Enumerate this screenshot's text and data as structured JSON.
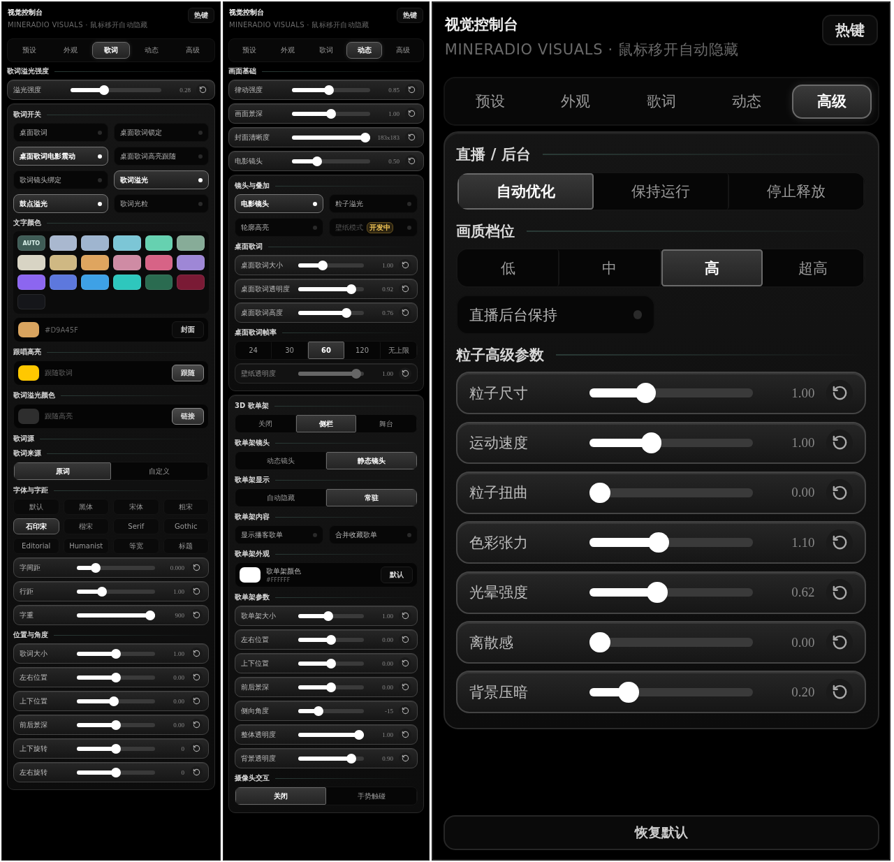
{
  "panels": [
    {
      "title": "视觉控制台",
      "subtitle": "MINERADIO VISUALS · 鼠标移开自动隐藏",
      "hotkey": "热键",
      "tabs": [
        {
          "label": "预设",
          "selected": false
        },
        {
          "label": "外观",
          "selected": false
        },
        {
          "label": "歌词",
          "selected": true
        },
        {
          "label": "动态",
          "selected": false
        },
        {
          "label": "高级",
          "selected": false
        }
      ],
      "blocks": [
        {
          "kind": "section",
          "label": "歌词溢光强度"
        },
        {
          "kind": "slider",
          "label": "溢光强度",
          "level": 0.35,
          "reading": "0.28",
          "disabled": false
        },
        {
          "kind": "card",
          "blocks": [
            {
              "kind": "section",
              "label": "歌词开关"
            },
            {
              "kind": "toggles",
              "items": [
                {
                  "label": "桌面歌词",
                  "on": false,
                  "disabled": false
                },
                {
                  "label": "桌面歌词锁定",
                  "on": false,
                  "disabled": false
                },
                {
                  "label": "桌面歌词电影震动",
                  "on": true,
                  "disabled": false
                },
                {
                  "label": "桌面歌词高亮跟随",
                  "on": false,
                  "disabled": false
                },
                {
                  "label": "歌词镜头绑定",
                  "on": false,
                  "disabled": false
                },
                {
                  "label": "歌词溢光",
                  "on": true,
                  "disabled": false
                },
                {
                  "label": "鼓点溢光",
                  "on": true,
                  "disabled": false
                },
                {
                  "label": "歌词光粒",
                  "on": false,
                  "disabled": false
                }
              ]
            },
            {
              "kind": "section",
              "label": "文字颜色"
            },
            {
              "kind": "swatches",
              "items": [
                {
                  "label": "AUTO",
                  "color": "#3f5c56"
                },
                {
                  "color": "#a9b8cf"
                },
                {
                  "color": "#9fb5cf"
                },
                {
                  "color": "#7cc6d6"
                },
                {
                  "color": "#66d1b0"
                },
                {
                  "color": "#87ac98"
                },
                {
                  "color": "#d8d4c4"
                },
                {
                  "color": "#cfb883"
                },
                {
                  "color": "#dfa55f"
                },
                {
                  "color": "#cf8ba4"
                },
                {
                  "color": "#d76386"
                },
                {
                  "color": "#9e87d6"
                },
                {
                  "color": "#8c66f0"
                },
                {
                  "color": "#5d78dd"
                },
                {
                  "color": "#3ea1e6"
                },
                {
                  "color": "#2ec7bd"
                },
                {
                  "color": "#2a6b50"
                },
                {
                  "color": "#7a1a35"
                },
                {
                  "color": "#15161a"
                }
              ]
            },
            {
              "kind": "color_row",
              "color": "#d9a45f",
              "label": "#D9A45F",
              "button": "封面",
              "active": false
            },
            {
              "kind": "section",
              "label": "跟唱高亮"
            },
            {
              "kind": "color_row",
              "color": "#ffc800",
              "label": "跟随歌词",
              "button": "跟随",
              "active": true
            },
            {
              "kind": "section",
              "label": "歌词溢光颜色"
            },
            {
              "kind": "color_row",
              "color": "#2e2e2e",
              "label": "跟随高亮",
              "button": "链接",
              "active": true
            },
            {
              "kind": "section",
              "label": "歌词源"
            },
            {
              "kind": "section",
              "label": "歌词来源"
            },
            {
              "kind": "segmented",
              "options": [
                {
                  "label": "原词",
                  "selected": true
                },
                {
                  "label": "自定义",
                  "selected": false
                }
              ]
            },
            {
              "kind": "section",
              "label": "字体与字距"
            },
            {
              "kind": "font_grid",
              "options": [
                {
                  "label": "默认",
                  "selected": false
                },
                {
                  "label": "黑体",
                  "selected": false
                },
                {
                  "label": "宋体",
                  "selected": false
                },
                {
                  "label": "粗宋",
                  "selected": false
                },
                {
                  "label": "石印宋",
                  "selected": true
                },
                {
                  "label": "楷宋",
                  "selected": false
                },
                {
                  "label": "Serif",
                  "selected": false
                },
                {
                  "label": "Gothic",
                  "selected": false
                },
                {
                  "label": "Editorial",
                  "selected": false
                },
                {
                  "label": "Humanist",
                  "selected": false
                },
                {
                  "label": "等宽",
                  "selected": false
                },
                {
                  "label": "标题",
                  "selected": false
                }
              ]
            },
            {
              "kind": "slider",
              "label": "字间距",
              "level": 0.2,
              "reading": "0.000",
              "disabled": false
            },
            {
              "kind": "slider",
              "label": "行距",
              "level": 0.3,
              "reading": "1.00",
              "disabled": false
            },
            {
              "kind": "slider",
              "label": "字重",
              "level": 1,
              "reading": "900",
              "disabled": false
            },
            {
              "kind": "section",
              "label": "位置与角度"
            },
            {
              "kind": "slider",
              "label": "歌词大小",
              "level": 0.5,
              "reading": "1.00",
              "disabled": false
            },
            {
              "kind": "slider",
              "label": "左右位置",
              "level": 0.5,
              "reading": "0.00",
              "disabled": false
            },
            {
              "kind": "slider",
              "label": "上下位置",
              "level": 0.47,
              "reading": "0.00",
              "disabled": false
            },
            {
              "kind": "slider",
              "label": "前后景深",
              "level": 0.5,
              "reading": "0.00",
              "disabled": false
            },
            {
              "kind": "slider",
              "label": "上下旋转",
              "level": 0.5,
              "reading": "0",
              "disabled": false
            },
            {
              "kind": "slider",
              "label": "左右旋转",
              "level": 0.5,
              "reading": "0",
              "disabled": false
            }
          ]
        }
      ]
    },
    {
      "title": "视觉控制台",
      "subtitle": "MINERADIO VISUALS · 鼠标移开自动隐藏",
      "hotkey": "热键",
      "tabs": [
        {
          "label": "预设",
          "selected": false
        },
        {
          "label": "外观",
          "selected": false
        },
        {
          "label": "歌词",
          "selected": false
        },
        {
          "label": "动态",
          "selected": true
        },
        {
          "label": "高级",
          "selected": false
        }
      ],
      "blocks": [
        {
          "kind": "section",
          "label": "画面基础"
        },
        {
          "kind": "slider",
          "label": "律动强度",
          "level": 0.47,
          "reading": "0.85",
          "disabled": false
        },
        {
          "kind": "slider",
          "label": "画面景深",
          "level": 0.5,
          "reading": "1.00",
          "disabled": false
        },
        {
          "kind": "slider",
          "label": "封面清晰度",
          "level": 1,
          "reading": "183x183",
          "disabled": false
        },
        {
          "kind": "slider",
          "label": "电影镜头",
          "level": 0.3,
          "reading": "0.50",
          "disabled": false
        },
        {
          "kind": "card",
          "blocks": [
            {
              "kind": "section",
              "label": "镜头与叠加"
            },
            {
              "kind": "toggles",
              "items": [
                {
                  "label": "电影镜头",
                  "on": true,
                  "disabled": false
                },
                {
                  "label": "粒子溢光",
                  "on": false,
                  "disabled": false
                },
                {
                  "label": "轮廓高亮",
                  "on": false,
                  "disabled": false
                },
                {
                  "label": "壁纸模式",
                  "on": false,
                  "disabled": true,
                  "badge": "开发中"
                }
              ]
            },
            {
              "kind": "section",
              "label": "桌面歌词"
            },
            {
              "kind": "slider",
              "label": "桌面歌词大小",
              "level": 0.35,
              "reading": "1.00",
              "disabled": false
            },
            {
              "kind": "slider",
              "label": "桌面歌词透明度",
              "level": 0.86,
              "reading": "0.92",
              "disabled": false
            },
            {
              "kind": "slider",
              "label": "桌面歌词高度",
              "level": 0.78,
              "reading": "0.76",
              "disabled": false
            },
            {
              "kind": "section",
              "label": "桌面歌词帧率"
            },
            {
              "kind": "segmented",
              "options": [
                {
                  "label": "24",
                  "selected": false
                },
                {
                  "label": "30",
                  "selected": false
                },
                {
                  "label": "60",
                  "selected": true
                },
                {
                  "label": "120",
                  "selected": false
                },
                {
                  "label": "无上限",
                  "selected": false
                }
              ]
            },
            {
              "kind": "slider",
              "label": "壁纸透明度",
              "level": 0.95,
              "reading": "1.00",
              "disabled": true
            }
          ]
        },
        {
          "kind": "card",
          "blocks": [
            {
              "kind": "section",
              "label": "3D 歌单架"
            },
            {
              "kind": "segmented",
              "options": [
                {
                  "label": "关闭",
                  "selected": false
                },
                {
                  "label": "侧栏",
                  "selected": true
                },
                {
                  "label": "舞台",
                  "selected": false
                }
              ]
            },
            {
              "kind": "section",
              "label": "歌单架镜头"
            },
            {
              "kind": "segmented",
              "options": [
                {
                  "label": "动态镜头",
                  "selected": false
                },
                {
                  "label": "静态镜头",
                  "selected": true
                }
              ]
            },
            {
              "kind": "section",
              "label": "歌单架显示"
            },
            {
              "kind": "segmented",
              "options": [
                {
                  "label": "自动隐藏",
                  "selected": false
                },
                {
                  "label": "常驻",
                  "selected": true
                }
              ]
            },
            {
              "kind": "section",
              "label": "歌单架内容"
            },
            {
              "kind": "toggles",
              "items": [
                {
                  "label": "显示播客歌单",
                  "on": false,
                  "disabled": false
                },
                {
                  "label": "合并收藏歌单",
                  "on": false,
                  "disabled": false
                }
              ]
            },
            {
              "kind": "section",
              "label": "歌单架外观"
            },
            {
              "kind": "color_row",
              "color": "#ffffff",
              "label": "歌单架颜色",
              "value": "#FFFFFF",
              "button": "默认",
              "active": false
            },
            {
              "kind": "section",
              "label": "歌单架参数"
            },
            {
              "kind": "slider",
              "label": "歌单架大小",
              "level": 0.45,
              "reading": "1.00",
              "disabled": false
            },
            {
              "kind": "slider",
              "label": "左右位置",
              "level": 0.5,
              "reading": "0.00",
              "disabled": false
            },
            {
              "kind": "slider",
              "label": "上下位置",
              "level": 0.5,
              "reading": "0.00",
              "disabled": false
            },
            {
              "kind": "slider",
              "label": "前后景深",
              "level": 0.5,
              "reading": "0.00",
              "disabled": false
            },
            {
              "kind": "slider",
              "label": "侧向角度",
              "level": 0.28,
              "reading": "-15",
              "disabled": false
            },
            {
              "kind": "slider",
              "label": "整体透明度",
              "level": 1,
              "reading": "1.00",
              "disabled": false
            },
            {
              "kind": "slider",
              "label": "背景透明度",
              "level": 0.86,
              "reading": "0.90",
              "disabled": false
            },
            {
              "kind": "section",
              "label": "摄像头交互"
            },
            {
              "kind": "segmented",
              "options": [
                {
                  "label": "关闭",
                  "selected": true
                },
                {
                  "label": "手势触碰",
                  "selected": false
                }
              ]
            }
          ]
        }
      ]
    },
    {
      "title": "视觉控制台",
      "subtitle": "MINERADIO VISUALS · 鼠标移开自动隐藏",
      "hotkey": "热键",
      "tabs": [
        {
          "label": "预设",
          "selected": false
        },
        {
          "label": "外观",
          "selected": false
        },
        {
          "label": "歌词",
          "selected": false
        },
        {
          "label": "动态",
          "selected": false
        },
        {
          "label": "高级",
          "selected": true
        }
      ],
      "blocks": [
        {
          "kind": "card",
          "blocks": [
            {
              "kind": "section",
              "label": "直播 / 后台"
            },
            {
              "kind": "segmented",
              "options": [
                {
                  "label": "自动优化",
                  "selected": true
                },
                {
                  "label": "保持运行",
                  "selected": false
                },
                {
                  "label": "停止释放",
                  "selected": false
                }
              ]
            },
            {
              "kind": "section",
              "label": "画质档位"
            },
            {
              "kind": "segmented",
              "options": [
                {
                  "label": "低",
                  "selected": false
                },
                {
                  "label": "中",
                  "selected": false
                },
                {
                  "label": "高",
                  "selected": true
                },
                {
                  "label": "超高",
                  "selected": false
                }
              ]
            },
            {
              "kind": "toggles",
              "items": [
                {
                  "label": "直播后台保持",
                  "on": false,
                  "disabled": false
                }
              ]
            },
            {
              "kind": "section",
              "label": "粒子高级参数"
            },
            {
              "kind": "slider",
              "label": "粒子尺寸",
              "level": 0.32,
              "reading": "1.00",
              "disabled": false
            },
            {
              "kind": "slider",
              "label": "运动速度",
              "level": 0.36,
              "reading": "1.00",
              "disabled": false
            },
            {
              "kind": "slider",
              "label": "粒子扭曲",
              "level": 0,
              "reading": "0.00",
              "disabled": false
            },
            {
              "kind": "slider",
              "label": "色彩张力",
              "level": 0.41,
              "reading": "1.10",
              "disabled": false
            },
            {
              "kind": "slider",
              "label": "光晕强度",
              "level": 0.4,
              "reading": "0.62",
              "disabled": false
            },
            {
              "kind": "slider",
              "label": "离散感",
              "level": 0,
              "reading": "0.00",
              "disabled": false
            },
            {
              "kind": "slider",
              "label": "背景压暗",
              "level": 0.2,
              "reading": "0.20",
              "disabled": false
            }
          ]
        }
      ],
      "footer_button": "恢复默认"
    }
  ]
}
